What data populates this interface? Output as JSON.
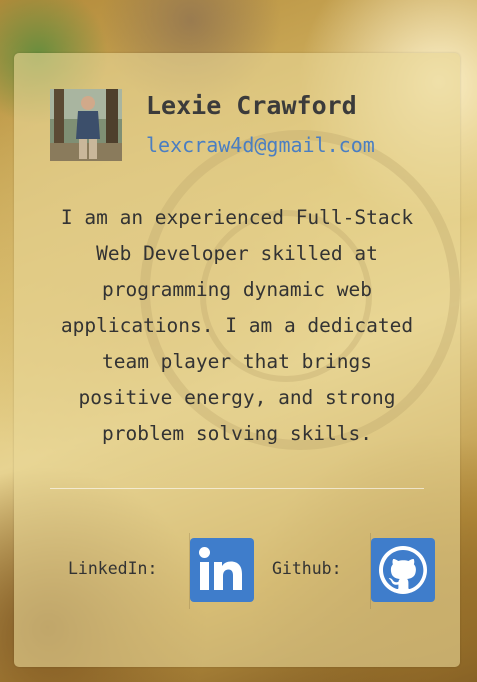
{
  "profile": {
    "name": "Lexie Crawford",
    "email": "lexcraw4d@gmail.com",
    "bio": "I am an experienced Full-Stack Web Developer skilled at programming dynamic web applications. I am a dedicated team player that brings positive energy, and strong problem solving skills."
  },
  "social": {
    "linkedin_label": "LinkedIn:",
    "github_label": "Github:",
    "linkedin_icon": "linkedin-icon",
    "github_icon": "github-icon"
  },
  "colors": {
    "accent": "#3f7dcb",
    "email": "#4a7ec2",
    "text": "#333333"
  }
}
